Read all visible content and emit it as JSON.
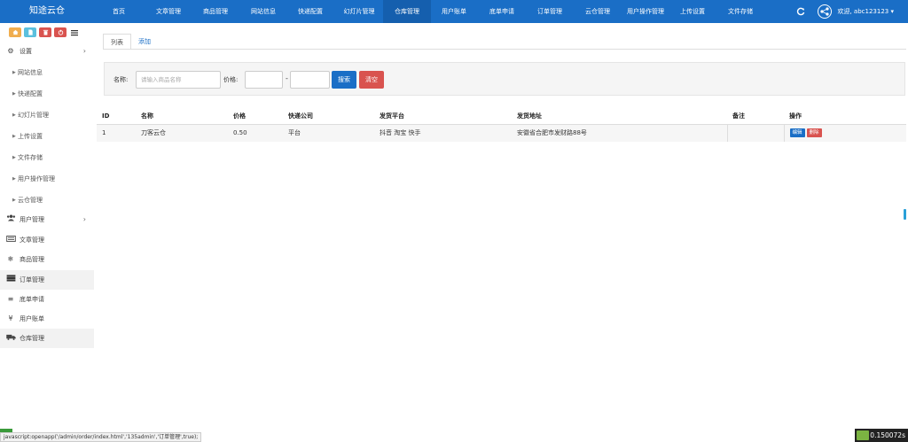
{
  "header": {
    "brand": "知途云仓",
    "nav": [
      {
        "label": "首页"
      },
      {
        "label": "文章管理"
      },
      {
        "label": "商品管理"
      },
      {
        "label": "网站信息"
      },
      {
        "label": "快递配置"
      },
      {
        "label": "幻灯片管理"
      },
      {
        "label": "仓库管理",
        "active": true
      },
      {
        "label": "用户账单"
      },
      {
        "label": "底单申请"
      },
      {
        "label": "订单管理"
      },
      {
        "label": "云仓管理"
      },
      {
        "label": "用户操作管理"
      },
      {
        "label": "上传设置"
      },
      {
        "label": "文件存储"
      }
    ],
    "user_label": "欢迎, abc123123",
    "user_caret": "▾"
  },
  "sidebar": {
    "toolbar": [
      {
        "icon": "home-icon",
        "color": "#f0ad4e"
      },
      {
        "icon": "file-icon",
        "color": "#5bc0de"
      },
      {
        "icon": "trash-icon",
        "color": "#d9534f"
      },
      {
        "icon": "power-icon",
        "color": "#d9534f"
      }
    ],
    "settings": {
      "label": "设置",
      "icon": "gears-icon"
    },
    "sub_items": [
      {
        "label": "网站信息"
      },
      {
        "label": "快递配置"
      },
      {
        "label": "幻灯片管理"
      },
      {
        "label": "上传设置"
      },
      {
        "label": "文件存储"
      },
      {
        "label": "用户操作管理"
      },
      {
        "label": "云仓管理"
      }
    ],
    "items": [
      {
        "label": "用户管理",
        "icon": "users-icon",
        "has_children": true
      },
      {
        "label": "文章管理",
        "icon": "keyboard-icon"
      },
      {
        "label": "商品管理",
        "icon": "snowflake-icon"
      },
      {
        "label": "订单管理",
        "icon": "server-icon",
        "highlight": true
      },
      {
        "label": "底单申请",
        "icon": "bars-icon"
      },
      {
        "label": "用户账单",
        "icon": "yen-icon"
      },
      {
        "label": "仓库管理",
        "icon": "truck-icon",
        "highlight": true
      }
    ]
  },
  "main": {
    "tabs": [
      {
        "label": "列表",
        "active": true
      },
      {
        "label": "添加"
      }
    ],
    "filter": {
      "name_label": "名称:",
      "name_placeholder": "请输入商品名称",
      "price_label": "价格:",
      "dash": "-",
      "search_label": "搜索",
      "clear_label": "清空"
    },
    "table": {
      "columns": [
        "ID",
        "名称",
        "价格",
        "快递公司",
        "发货平台",
        "发货地址",
        "备注",
        "操作"
      ],
      "rows": [
        {
          "id": "1",
          "name": "刀客云仓",
          "price": "0.50",
          "courier": "平台",
          "platform": "抖音 淘宝 快手",
          "address": "安徽省合肥市发财路88号",
          "note": "",
          "edit_label": "编辑",
          "delete_label": "删除"
        }
      ]
    }
  },
  "statusbar": {
    "text": "javascript:openapp('/admin/order/index.html','135admin','订单管理',true);"
  },
  "timer": {
    "value": "0.150072s"
  }
}
